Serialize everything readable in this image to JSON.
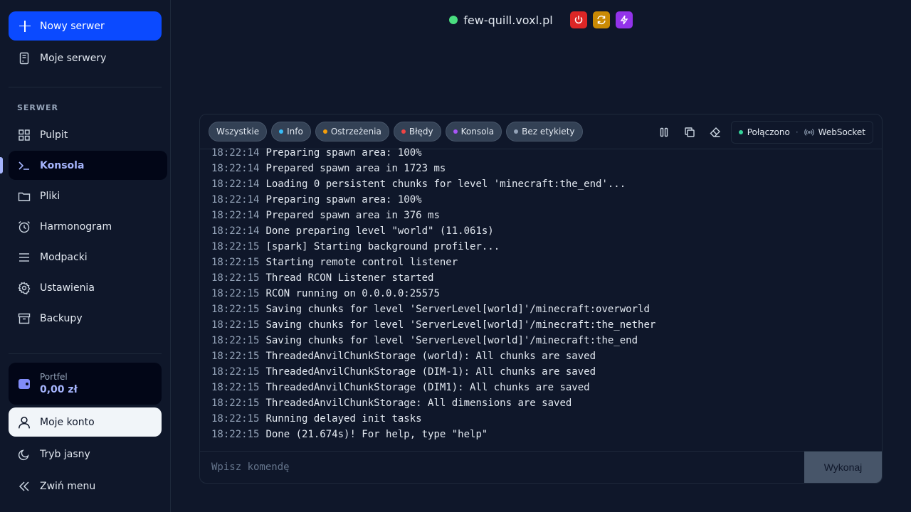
{
  "sidebar": {
    "new_server": "Nowy serwer",
    "my_servers": "Moje serwery",
    "section": "SERWER",
    "items": [
      {
        "label": "Pulpit",
        "icon": "dashboard-icon"
      },
      {
        "label": "Konsola",
        "icon": "terminal-icon"
      },
      {
        "label": "Pliki",
        "icon": "folder-icon"
      },
      {
        "label": "Harmonogram",
        "icon": "alarm-clock-icon"
      },
      {
        "label": "Modpacki",
        "icon": "list-icon"
      },
      {
        "label": "Ustawienia",
        "icon": "gear-icon"
      },
      {
        "label": "Backupy",
        "icon": "archive-icon"
      }
    ],
    "wallet_title": "Portfel",
    "wallet_value": "0,00 zł",
    "account": "Moje konto",
    "theme": "Tryb jasny",
    "collapse": "Zwiń menu"
  },
  "header": {
    "server_name": "few-quill.voxl.pl",
    "status_color": "#4ade80",
    "power_buttons": [
      {
        "icon": "power-icon",
        "color": "#dc2626"
      },
      {
        "icon": "restart-icon",
        "color": "#ca8a04"
      },
      {
        "icon": "kill-icon",
        "color": "#9333ea"
      }
    ]
  },
  "console": {
    "filters": [
      {
        "label": "Wszystkie",
        "dot": ""
      },
      {
        "label": "Info",
        "dot": "#38bdf8"
      },
      {
        "label": "Ostrzeżenia",
        "dot": "#f59e0b"
      },
      {
        "label": "Błędy",
        "dot": "#ef4444"
      },
      {
        "label": "Konsola",
        "dot": "#a855f7"
      },
      {
        "label": "Bez etykiety",
        "dot": "#94a3b8"
      }
    ],
    "connection_status": "Połączono",
    "connection_type": "WebSocket",
    "lines": [
      {
        "ts": "18:22:14",
        "msg": "Preparing spawn area: 100%"
      },
      {
        "ts": "18:22:14",
        "msg": "Prepared spawn area in 1723 ms"
      },
      {
        "ts": "18:22:14",
        "msg": "Loading 0 persistent chunks for level 'minecraft:the_end'..."
      },
      {
        "ts": "18:22:14",
        "msg": "Preparing spawn area: 100%"
      },
      {
        "ts": "18:22:14",
        "msg": "Prepared spawn area in 376 ms"
      },
      {
        "ts": "18:22:14",
        "msg": "Done preparing level \"world\" (11.061s)"
      },
      {
        "ts": "18:22:15",
        "msg": "[spark] Starting background profiler..."
      },
      {
        "ts": "18:22:15",
        "msg": "Starting remote control listener"
      },
      {
        "ts": "18:22:15",
        "msg": "Thread RCON Listener started"
      },
      {
        "ts": "18:22:15",
        "msg": "RCON running on 0.0.0.0:25575"
      },
      {
        "ts": "18:22:15",
        "msg": "Saving chunks for level 'ServerLevel[world]'/minecraft:overworld"
      },
      {
        "ts": "18:22:15",
        "msg": "Saving chunks for level 'ServerLevel[world]'/minecraft:the_nether"
      },
      {
        "ts": "18:22:15",
        "msg": "Saving chunks for level 'ServerLevel[world]'/minecraft:the_end"
      },
      {
        "ts": "18:22:15",
        "msg": "ThreadedAnvilChunkStorage (world): All chunks are saved"
      },
      {
        "ts": "18:22:15",
        "msg": "ThreadedAnvilChunkStorage (DIM-1): All chunks are saved"
      },
      {
        "ts": "18:22:15",
        "msg": "ThreadedAnvilChunkStorage (DIM1): All chunks are saved"
      },
      {
        "ts": "18:22:15",
        "msg": "ThreadedAnvilChunkStorage: All dimensions are saved"
      },
      {
        "ts": "18:22:15",
        "msg": "Running delayed init tasks"
      },
      {
        "ts": "18:22:15",
        "msg": "Done (21.674s)! For help, type \"help\""
      }
    ],
    "input_placeholder": "Wpisz komendę",
    "execute_label": "Wykonaj"
  }
}
